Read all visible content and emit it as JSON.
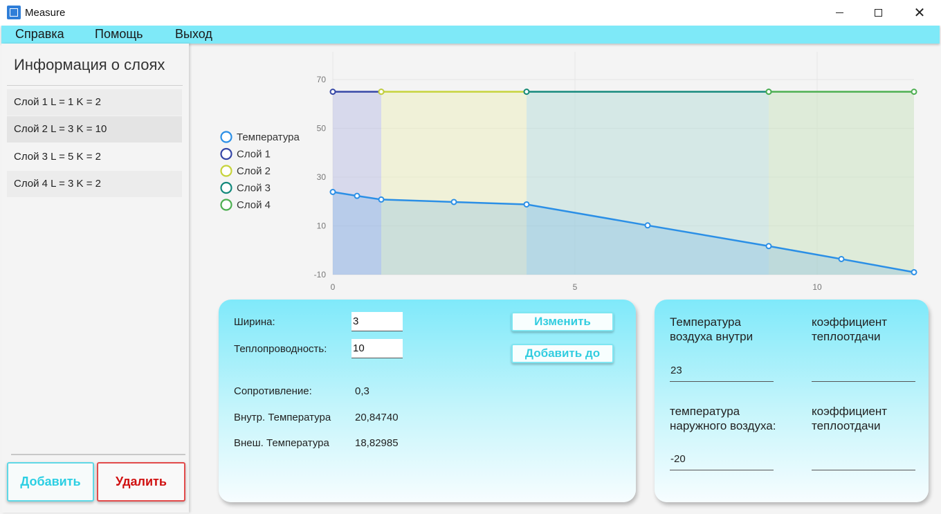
{
  "window": {
    "title": "Measure",
    "minimize": "—",
    "maximize": "□",
    "close": "✕"
  },
  "menu": {
    "items": [
      "Справка",
      "Помощь",
      "Выход"
    ]
  },
  "sidebar": {
    "title": "Информация о слоях",
    "layers": [
      "Слой 1  L = 1  K = 2",
      "Слой 2  L = 3  K = 10",
      "Слой 3  L = 5  K = 2",
      "Слой 4  L = 3  K = 2"
    ],
    "add_label": "Добавить",
    "delete_label": "Удалить"
  },
  "chart_data": {
    "type": "area",
    "legend_position": "left",
    "grid": true,
    "xlim": [
      0,
      12
    ],
    "ylim": [
      -10,
      70
    ],
    "x_ticks": [
      0,
      5,
      10
    ],
    "y_ticks": [
      70,
      50,
      30,
      10,
      -10
    ],
    "series": [
      {
        "name": "Температура",
        "color": "#2b8fe6",
        "x": [
          0,
          0.5,
          1,
          2.5,
          4,
          6.5,
          9,
          10.5,
          12
        ],
        "y": [
          23.9,
          22.3,
          20.8,
          19.8,
          18.8,
          10.2,
          1.7,
          -3.6,
          -9
        ]
      },
      {
        "name": "Слой 1",
        "color": "#3546a6",
        "x": [
          0,
          1
        ],
        "y": [
          65,
          65
        ]
      },
      {
        "name": "Слой 2",
        "color": "#c6d33a",
        "x": [
          1,
          4
        ],
        "y": [
          65,
          65
        ]
      },
      {
        "name": "Слой 3",
        "color": "#14897c",
        "x": [
          4,
          9
        ],
        "y": [
          65,
          65
        ]
      },
      {
        "name": "Слой 4",
        "color": "#4caf50",
        "x": [
          9,
          12
        ],
        "y": [
          65,
          65
        ]
      }
    ]
  },
  "layer_form": {
    "width_label": "Ширина:",
    "width_value": "3",
    "conductivity_label": "Теплопроводность:",
    "conductivity_value": "10",
    "change_label": "Изменить",
    "add_to_label": "Добавить до",
    "resistance_label": "Сопротивление:",
    "resistance_value": "0,3",
    "inner_temp_label": "Внутр. Температура",
    "inner_temp_value": "20,84740",
    "outer_temp_label": "Внеш. Температура",
    "outer_temp_value": "18,82985"
  },
  "air_form": {
    "inside_temp_label_1": "Температура",
    "inside_temp_label_2": "воздуха внутри",
    "inside_temp_value": "23",
    "coef1_label_1": "коэффициент",
    "coef1_label_2": "теплоотдачи",
    "coef1_value": "",
    "outside_temp_label_1": "температура",
    "outside_temp_label_2": "наружного воздуха:",
    "outside_temp_value": "-20",
    "coef2_label_1": "коэффициент",
    "coef2_label_2": "теплоотдачи",
    "coef2_value": ""
  }
}
